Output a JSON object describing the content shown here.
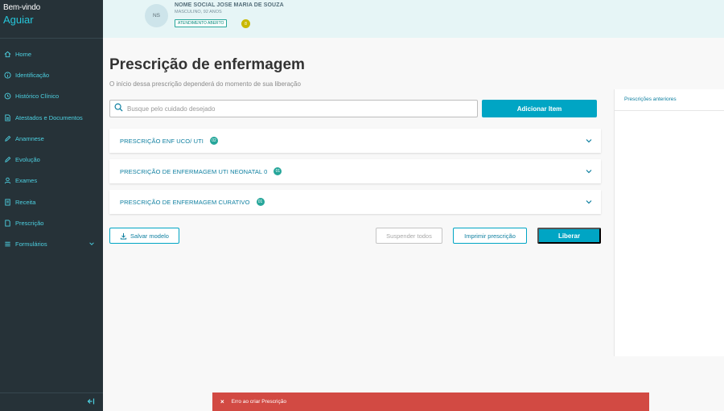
{
  "sidebar": {
    "welcome": "Bem-vindo",
    "user": "Aguiar",
    "items": [
      {
        "label": "Home",
        "icon": "home-icon"
      },
      {
        "label": "Identificação",
        "icon": "info-icon"
      },
      {
        "label": "Histórico Clínico",
        "icon": "history-icon"
      },
      {
        "label": "Atestados e Documentos",
        "icon": "document-icon"
      },
      {
        "label": "Anamnese",
        "icon": "pencil-icon"
      },
      {
        "label": "Evolução",
        "icon": "edit-icon"
      },
      {
        "label": "Exames",
        "icon": "user-icon"
      },
      {
        "label": "Receita",
        "icon": "receipt-icon"
      },
      {
        "label": "Prescrição",
        "icon": "file-icon"
      },
      {
        "label": "Formulários",
        "icon": "list-icon"
      }
    ]
  },
  "patient": {
    "initials": "NS",
    "name": "NOME SOCIAL JOSE MARIA DE SOUZA",
    "info": "MASCULINO, 92 ANOS",
    "status": "ATENDIMENTO ABERTO",
    "badge": "8"
  },
  "main": {
    "title": "Prescrição de enfermagem",
    "subtitle": "O início dessa prescrição dependerá do momento de sua liberação",
    "search_placeholder": "Busque pelo cuidado desejado",
    "add_label": "Adicionar Item",
    "accordions": [
      {
        "label": "PRESCRIÇÃO ENF UCO/ UTI",
        "count": "02"
      },
      {
        "label": "PRESCRIÇÃO DE ENFERMAGEM UTI NEONATAL 0",
        "count": "01"
      },
      {
        "label": "PRESCRIÇÃO DE ENFERMAGEM CURATIVO",
        "count": "01"
      }
    ],
    "save_model": "Salvar modelo",
    "suspend_all": "Suspender todos",
    "print": "Imprimir prescrição",
    "release": "Liberar"
  },
  "right_panel": {
    "title": "Prescrições anteriores"
  },
  "toast": {
    "message": "Erro ao criar Prescrição"
  },
  "colors": {
    "sidebar_bg": "#263238",
    "accent": "#00a5c4",
    "header_bg": "#e6f5f6",
    "error": "#d24a43"
  }
}
